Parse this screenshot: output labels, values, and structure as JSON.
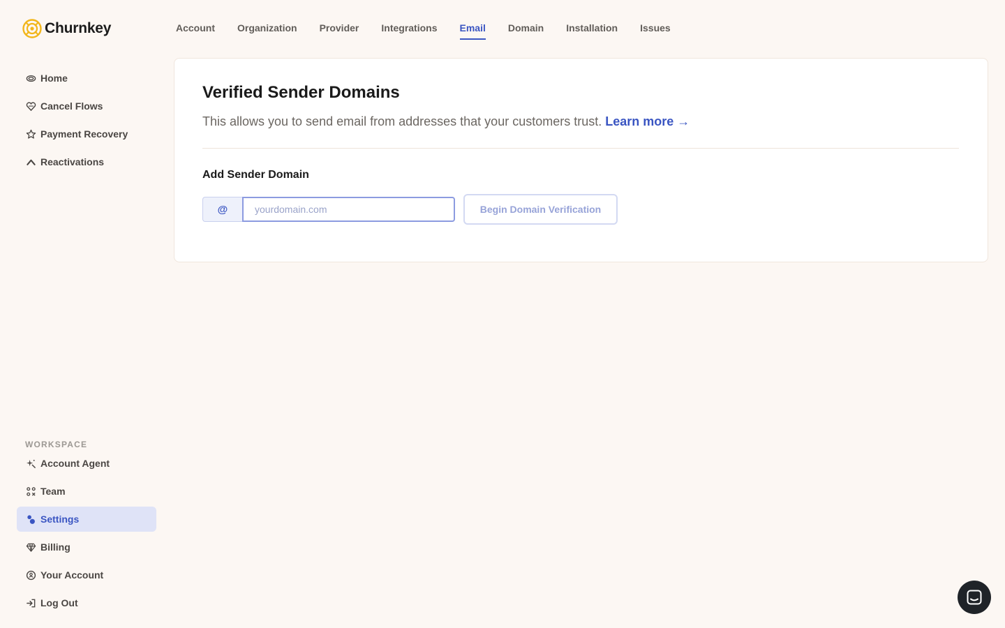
{
  "brand": {
    "name": "Churnkey",
    "accent": "#f2b61b"
  },
  "sidebar": {
    "main": [
      {
        "label": "Home",
        "icon": "eye-icon"
      },
      {
        "label": "Cancel Flows",
        "icon": "heart-icon"
      },
      {
        "label": "Payment Recovery",
        "icon": "star-icon"
      },
      {
        "label": "Reactivations",
        "icon": "arrow-up-icon"
      }
    ],
    "workspace_label": "WORKSPACE",
    "workspace": [
      {
        "label": "Account Agent",
        "icon": "sparkle-icon"
      },
      {
        "label": "Team",
        "icon": "team-icon"
      },
      {
        "label": "Settings",
        "icon": "settings-icon",
        "active": true
      },
      {
        "label": "Billing",
        "icon": "diamond-icon"
      },
      {
        "label": "Your Account",
        "icon": "user-circle-icon"
      },
      {
        "label": "Log Out",
        "icon": "logout-icon"
      }
    ]
  },
  "tabs": [
    {
      "label": "Account"
    },
    {
      "label": "Organization"
    },
    {
      "label": "Provider"
    },
    {
      "label": "Integrations"
    },
    {
      "label": "Email",
      "active": true
    },
    {
      "label": "Domain"
    },
    {
      "label": "Installation"
    },
    {
      "label": "Issues"
    }
  ],
  "card": {
    "title": "Verified Sender Domains",
    "description": "This allows you to send email from addresses that your customers trust.",
    "learn_more": "Learn more →",
    "section_title": "Add Sender Domain",
    "prefix": "@",
    "input_placeholder": "yourdomain.com",
    "input_value": "",
    "button_label": "Begin Domain Verification"
  },
  "colors": {
    "primary": "#3a55c2",
    "background": "#fcf7f3",
    "active_bg": "#dfe3f7"
  }
}
